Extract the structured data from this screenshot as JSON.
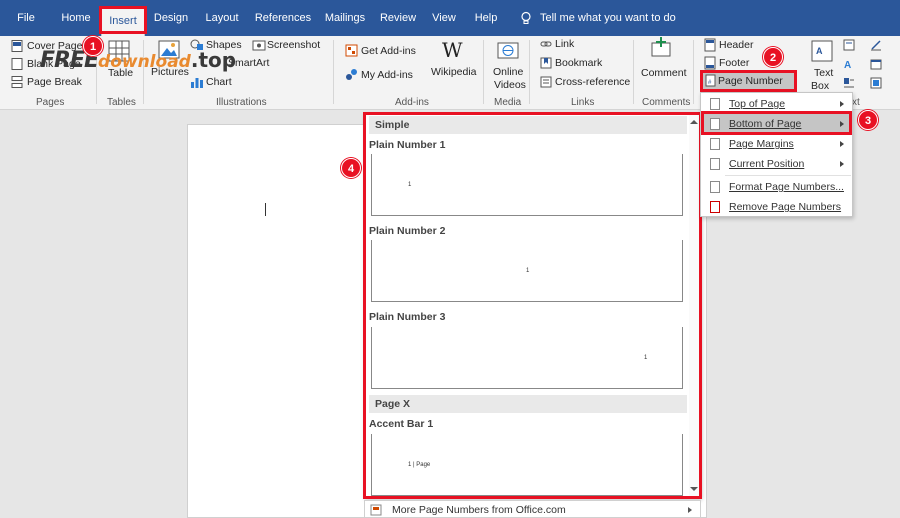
{
  "tabs": [
    "File",
    "Home",
    "Insert",
    "Design",
    "Layout",
    "References",
    "Mailings",
    "Review",
    "View",
    "Help"
  ],
  "tell_me": "Tell me what you want to do",
  "ribbon": {
    "pages": {
      "cover_page": "Cover Page",
      "blank_page": "Blank Page",
      "page_break": "Page Break",
      "group": "Pages"
    },
    "tables": {
      "table": "Table",
      "group": "Tables"
    },
    "illustrations": {
      "pictures": "Pictures",
      "shapes": "Shapes",
      "smartart": "SmartArt",
      "chart": "Chart",
      "screenshot": "Screenshot",
      "group": "Illustrations"
    },
    "addins": {
      "get_addins": "Get Add-ins",
      "my_addins": "My Add-ins",
      "wikipedia": "Wikipedia",
      "group": "Add-ins"
    },
    "media": {
      "online_videos_1": "Online",
      "online_videos_2": "Videos",
      "group": "Media"
    },
    "links": {
      "link": "Link",
      "bookmark": "Bookmark",
      "cross_reference": "Cross-reference",
      "group": "Links"
    },
    "comments": {
      "comment": "Comment",
      "group": "Comments"
    },
    "header_footer": {
      "header": "Header",
      "footer": "Footer",
      "page_number": "Page Number"
    },
    "text": {
      "text_box_1": "Text",
      "text_box_2": "Box",
      "group_partial": "xt"
    }
  },
  "menu": {
    "items": [
      "Top of Page",
      "Bottom of Page",
      "Page Margins",
      "Current Position",
      "Format Page Numbers...",
      "Remove Page Numbers"
    ]
  },
  "gallery": {
    "section_simple": "Simple",
    "plain_number_1": "Plain Number 1",
    "plain_number_2": "Plain Number 2",
    "plain_number_3": "Plain Number 3",
    "section_pagex": "Page X",
    "accent_bar_1": "Accent Bar 1",
    "sample_number": "1",
    "accent_sample": "1 | Page",
    "more": "More Page Numbers from Office.com"
  },
  "callouts": [
    "1",
    "2",
    "3",
    "4"
  ],
  "watermark": {
    "part1": "FREE",
    "part2": "download",
    "part3": ".top"
  },
  "colors": {
    "accent": "#2b579a",
    "callout": "#e81123",
    "highlight": "#c5c5c5"
  }
}
